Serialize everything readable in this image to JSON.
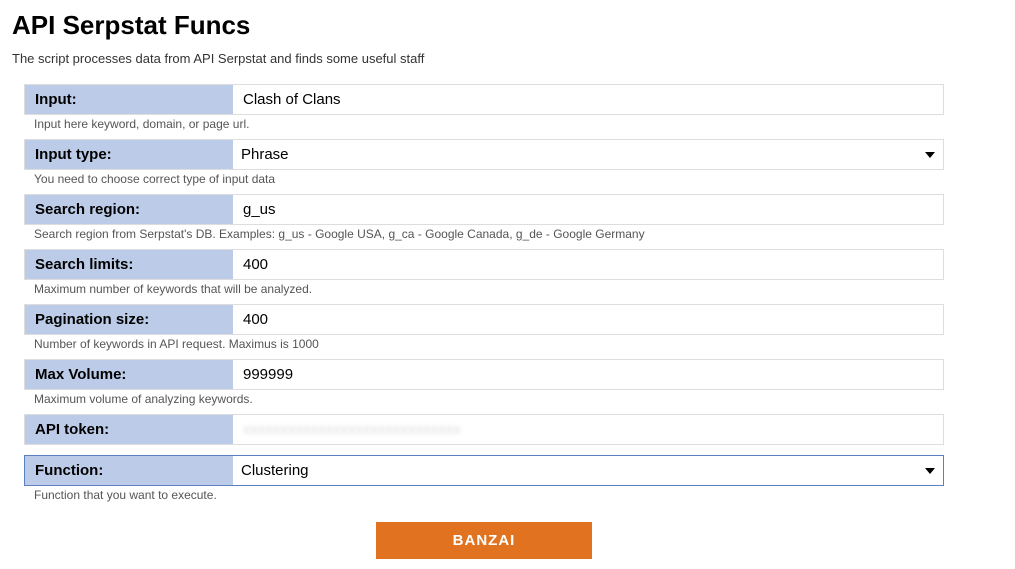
{
  "page": {
    "title": "API Serpstat Funcs",
    "subtitle": "The script processes data from API Serpstat and finds some useful staff"
  },
  "form": {
    "input": {
      "label": "Input:",
      "value": "Clash of Clans",
      "hint": "Input here keyword, domain, or page url."
    },
    "input_type": {
      "label": "Input type:",
      "value": "Phrase",
      "hint": "You need to choose correct type of input data"
    },
    "search_region": {
      "label": "Search region:",
      "value": "g_us",
      "hint": "Search region from Serpstat's DB. Examples: g_us - Google USA, g_ca - Google Canada, g_de - Google Germany"
    },
    "search_limits": {
      "label": "Search limits:",
      "value": "400",
      "hint": "Maximum number of keywords that will be analyzed."
    },
    "pagination_size": {
      "label": "Pagination size:",
      "value": "400",
      "hint": "Number of keywords in API request. Maximus is 1000"
    },
    "max_volume": {
      "label": "Max Volume:",
      "value": "999999",
      "hint": "Maximum volume of analyzing keywords."
    },
    "api_token": {
      "label": "API token:",
      "value": "xxxxxxxxxxxxxxxxxxxxxxxxxxxxx"
    },
    "function": {
      "label": "Function:",
      "value": "Clustering",
      "hint": "Function that you want to execute."
    },
    "submit": {
      "label": "BANZAI"
    }
  }
}
